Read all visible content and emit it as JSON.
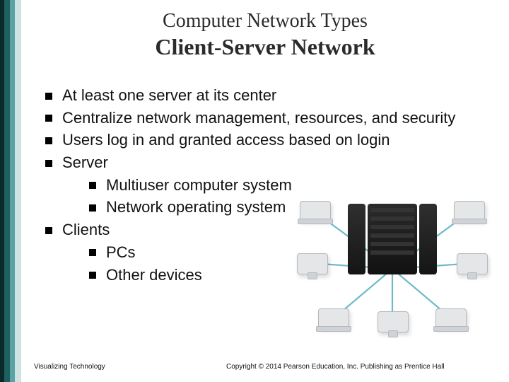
{
  "header": {
    "supertitle": "Computer Network Types",
    "title": "Client-Server Network"
  },
  "bullets": [
    {
      "text": "At least one server at its center"
    },
    {
      "text": "Centralize network management, resources, and security"
    },
    {
      "text": "Users log in and granted access based on login"
    },
    {
      "text": "Server",
      "sub": [
        {
          "text": "Multiuser computer system"
        },
        {
          "text": "Network operating system"
        }
      ]
    },
    {
      "text": "Clients",
      "sub": [
        {
          "text": "PCs"
        },
        {
          "text": "Other devices"
        }
      ]
    }
  ],
  "footer": {
    "left": "Visualizing Technology",
    "right": "Copyright © 2014 Pearson Education, Inc. Publishing as Prentice Hall"
  }
}
